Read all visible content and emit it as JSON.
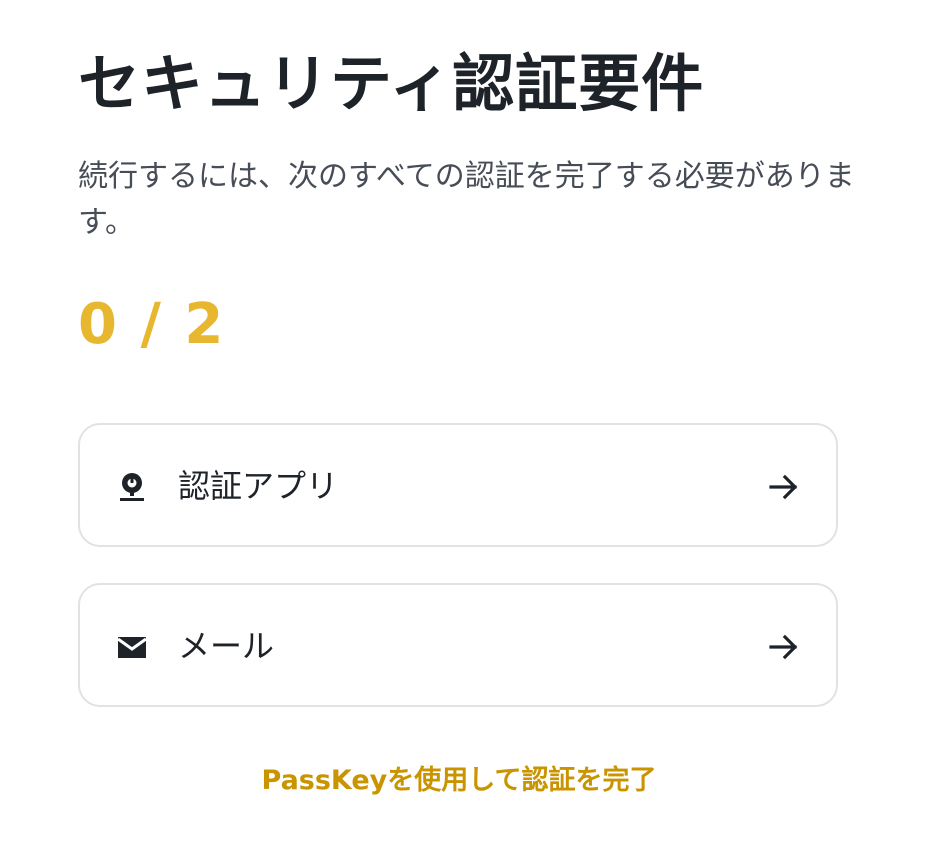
{
  "header": {
    "title": "セキュリティ認証要件"
  },
  "description": "続行するには、次のすべての認証を完了する必要があります。",
  "progress": {
    "text": "0 / 2",
    "completed": 0,
    "total": 2
  },
  "methods": [
    {
      "label": "認証アプリ",
      "icon": "authenticator-icon",
      "action_icon": "arrow-right-icon"
    },
    {
      "label": "メール",
      "icon": "mail-icon",
      "action_icon": "arrow-right-icon"
    }
  ],
  "passkey_link": "PassKeyを使用して認証を完了",
  "colors": {
    "title": "#1e2329",
    "description": "#474d57",
    "progress": "#e8b730",
    "card_border": "#e0e2e5",
    "link": "#c99400"
  }
}
